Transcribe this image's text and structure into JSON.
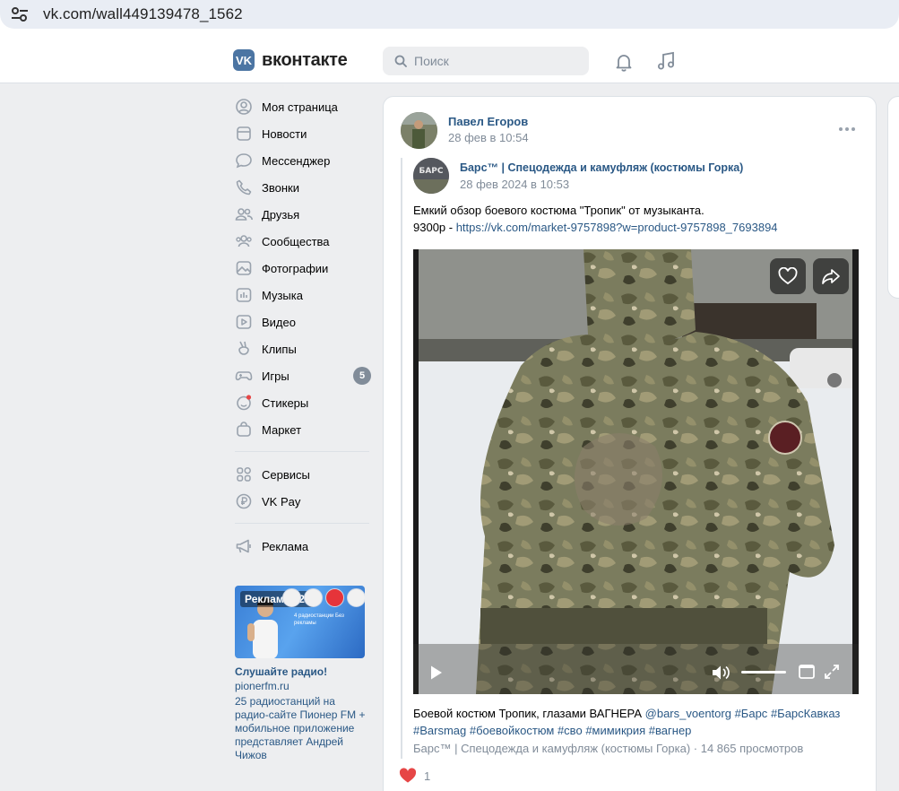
{
  "browser": {
    "url": "vk.com/wall449139478_1562",
    "site_icon": "tune-icon"
  },
  "header": {
    "logo_text": "вконтакте",
    "logo_mark": "VK",
    "search_placeholder": "Поиск"
  },
  "menu": [
    {
      "label": "Моя страница",
      "icon": "user-circle-icon"
    },
    {
      "label": "Новости",
      "icon": "news-icon"
    },
    {
      "label": "Мессенджер",
      "icon": "message-icon"
    },
    {
      "label": "Звонки",
      "icon": "phone-icon"
    },
    {
      "label": "Друзья",
      "icon": "friends-icon"
    },
    {
      "label": "Сообщества",
      "icon": "communities-icon"
    },
    {
      "label": "Фотографии",
      "icon": "photo-icon"
    },
    {
      "label": "Музыка",
      "icon": "music-chart-icon"
    },
    {
      "label": "Видео",
      "icon": "video-icon"
    },
    {
      "label": "Клипы",
      "icon": "clips-icon"
    },
    {
      "label": "Игры",
      "icon": "gamepad-icon",
      "badge": "5"
    },
    {
      "label": "Стикеры",
      "icon": "sticker-icon"
    },
    {
      "label": "Маркет",
      "icon": "market-bag-icon"
    }
  ],
  "menu2": [
    {
      "label": "Сервисы",
      "icon": "services-icon"
    },
    {
      "label": "VK Pay",
      "icon": "vkpay-icon"
    }
  ],
  "menu3": [
    {
      "label": "Реклама",
      "icon": "megaphone-icon"
    }
  ],
  "ad": {
    "tag": "Реклама 12+",
    "image_text": "4 радиостанции Без рекламы",
    "title": "Слушайте радио!",
    "domain": "pionerfm.ru",
    "text": "25 радиостанций на радио-сайте Пионер FM + мобильное приложение представляет Андрей Чижов"
  },
  "post": {
    "author": "Павел Егоров",
    "date": "28 фев в 10:54",
    "repost": {
      "group": "Барс™ | Спецодежда и камуфляж (костюмы Горка)",
      "avatar_text": "БАРС",
      "date": "28 фев 2024 в 10:53",
      "text_line1": "Емкий обзор боевого костюма \"Тропик\" от музыканта.",
      "price": "9300р - ",
      "link": "https://vk.com/market-9757898?w=product-9757898_7693894"
    },
    "video": {
      "caption_text": "Боевой костюм Тропик, глазами ВАГНЕРА ",
      "mention": "@bars_voentorg",
      "tag1": "#Барс",
      "tag2": "#БарсКавказ",
      "tag3": "#Barsmag",
      "tag4": "#боевойкостюм",
      "tag5": "#сво",
      "tag6": "#мимикрия",
      "tag7": "#вагнер",
      "source": "Барс™ | Спецодежда и камуфляж (костюмы Горка)",
      "views": "14 865 просмотров"
    },
    "likes_count": "1"
  },
  "colors": {
    "link": "#2a5885",
    "muted": "#818c99",
    "like": "#e64646",
    "bg": "#edeef0"
  }
}
